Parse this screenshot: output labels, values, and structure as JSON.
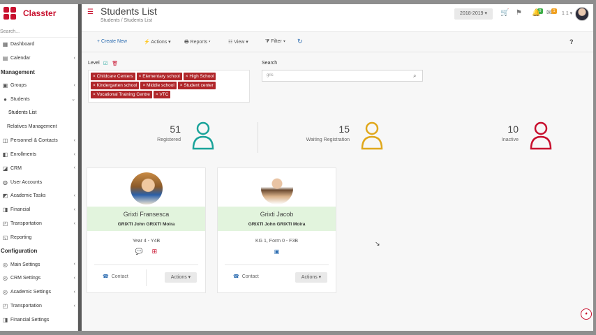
{
  "app": {
    "name": "Classter",
    "brand_color": "#c8102e"
  },
  "sidebar": {
    "search_placeholder": "Search...",
    "items": [
      {
        "label": "Dashboard",
        "icon": "dashboard-icon"
      },
      {
        "label": "Calendar",
        "icon": "calendar-icon"
      }
    ],
    "sections": [
      {
        "title": "Management"
      },
      {
        "title": "Configuration"
      }
    ],
    "mgmt": [
      {
        "label": "Groups"
      },
      {
        "label": "Students"
      },
      {
        "label": "Students List"
      },
      {
        "label": "Relatives Management"
      },
      {
        "label": "Personnel & Contacts"
      },
      {
        "label": "Enrollments"
      },
      {
        "label": "CRM"
      },
      {
        "label": "User Accounts"
      },
      {
        "label": "Academic Tasks"
      },
      {
        "label": "Financial"
      },
      {
        "label": "Transportation"
      },
      {
        "label": "Reporting"
      }
    ],
    "config": [
      {
        "label": "Main Settings"
      },
      {
        "label": "CRM Settings"
      },
      {
        "label": "Academic Settings"
      },
      {
        "label": "Transportation"
      },
      {
        "label": "Financial Settings"
      }
    ]
  },
  "header": {
    "title": "Students List",
    "breadcrumb": [
      "Students",
      "/",
      "Students List"
    ],
    "year": "2018-2019 ▾",
    "flag_badge": "9",
    "bell_badge": "1",
    "user_short": "1 1 ▾"
  },
  "toolbar": {
    "create": "+ Create New",
    "actions": "Actions ▾",
    "reports": "Reports ▾",
    "view": "View ▾",
    "filter": "Filter ▾",
    "refresh": "↻",
    "help": "?"
  },
  "filters": {
    "level_label": "Level",
    "tags": [
      "Childcare Centers",
      "Elementary school",
      "High School",
      "Kindergarten school",
      "Middle school",
      "Student center",
      "Vocational Training Centre",
      "VTC"
    ],
    "search_label": "Search",
    "search_value": "gris"
  },
  "stats": [
    {
      "value": "51",
      "label": "Registered",
      "color": "#1aa39a"
    },
    {
      "value": "15",
      "label": "Waiting Registration",
      "color": "#e0a81c"
    },
    {
      "value": "10",
      "label": "Inactive",
      "color": "#c8102e"
    }
  ],
  "cards": [
    {
      "name": "Grixti Fransesca",
      "parents": "GRIXTI John GRIXTI Moira",
      "class": "Year 4  -  Y4B",
      "contact": "Contact",
      "actions": "Actions ▾"
    },
    {
      "name": "Grixti Jacob",
      "parents": "GRIXTI John GRIXTI Moira",
      "class": "KG 1, Form 0  -  F3B",
      "contact": "Contact",
      "actions": "Actions ▾"
    }
  ]
}
